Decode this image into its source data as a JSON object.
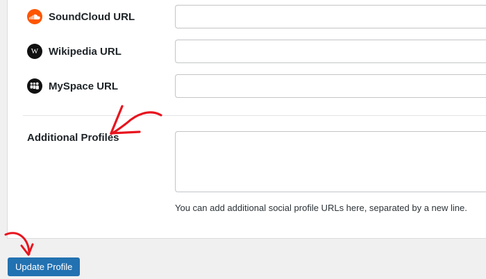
{
  "fields": {
    "soundcloud": {
      "label": "SoundCloud URL",
      "value": "",
      "icon": "soundcloud-icon",
      "icon_color": "#ff5500"
    },
    "wikipedia": {
      "label": "Wikipedia URL",
      "value": "",
      "icon": "wikipedia-icon",
      "icon_color": "#111111"
    },
    "myspace": {
      "label": "MySpace URL",
      "value": "",
      "icon": "myspace-icon",
      "icon_color": "#111111"
    }
  },
  "additional_profiles": {
    "label": "Additional Profiles",
    "value": "",
    "help_text": "You can add additional social profile URLs here, separated by a new line."
  },
  "actions": {
    "update_label": "Update Profile"
  },
  "colors": {
    "primary_button": "#2271b1",
    "annotation_arrow": "#e8141e",
    "page_background": "#f0f0f1"
  }
}
